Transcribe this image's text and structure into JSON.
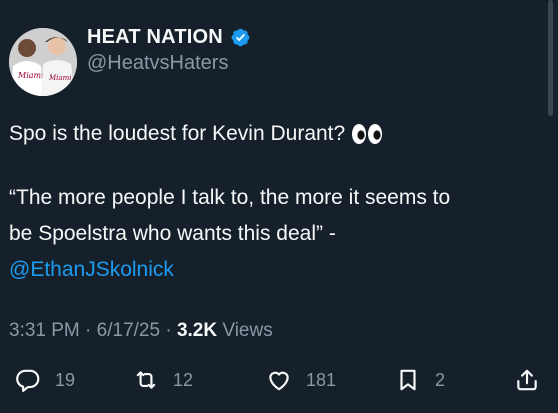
{
  "author": {
    "display_name": "HEAT NATION",
    "handle": "@HeatvsHaters",
    "verified": true,
    "avatar_colors": {
      "jersey": "#ffffff",
      "accent": "#98002e",
      "skin": "#6b4a38"
    }
  },
  "tweet": {
    "line1": "Spo is the loudest for Kevin Durant?",
    "line1_emoji": "eyes",
    "quote_line1": "“The more people I talk to, the more it seems to",
    "quote_line2": "be Spoelstra who wants this deal” -",
    "mention": "@EthanJSkolnick"
  },
  "meta": {
    "time": "3:31 PM",
    "separator": "·",
    "date": "6/17/25",
    "views_count": "3.2K",
    "views_label": "Views"
  },
  "actions": {
    "replies": "19",
    "reposts": "12",
    "likes": "181",
    "bookmarks": "2"
  },
  "colors": {
    "background": "#15202b",
    "text": "#f7f9f9",
    "secondary": "#8b98a5",
    "link": "#1d9bf0",
    "verified": "#1d9bf0"
  }
}
